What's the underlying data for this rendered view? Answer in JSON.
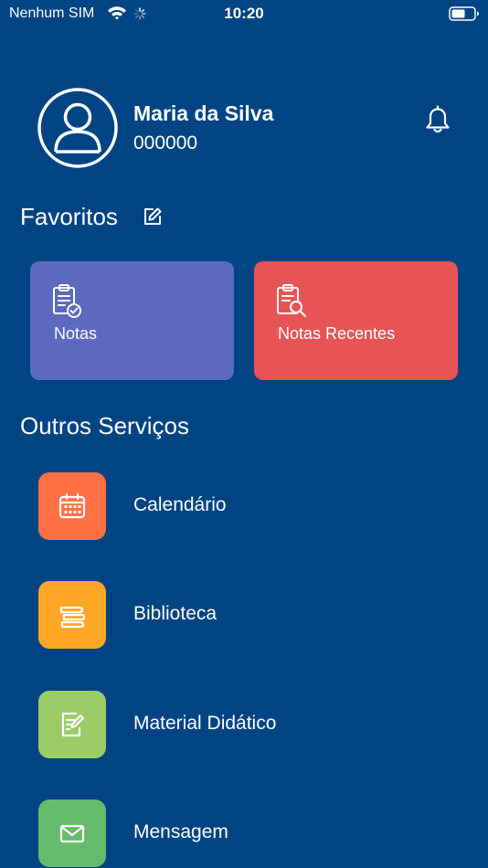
{
  "status_bar": {
    "carrier": "Nenhum SIM",
    "time": "10:20"
  },
  "profile": {
    "name": "Maria da Silva",
    "id": "000000"
  },
  "favorites": {
    "title": "Favoritos",
    "cards": [
      {
        "label": "Notas",
        "color": "#5c69be",
        "icon": "clipboard-check-icon"
      },
      {
        "label": "Notas Recentes",
        "color": "#e75455",
        "icon": "clipboard-search-icon"
      }
    ]
  },
  "services": {
    "title": "Outros Serviços",
    "items": [
      {
        "label": "Calendário",
        "color": "#ff7043",
        "icon": "calendar-icon"
      },
      {
        "label": "Biblioteca",
        "color": "#ffa726",
        "icon": "books-icon"
      },
      {
        "label": "Material Didático",
        "color": "#9ccc65",
        "icon": "document-edit-icon"
      },
      {
        "label": "Mensagem",
        "color": "#66bb6a",
        "icon": "envelope-icon"
      }
    ]
  },
  "colors": {
    "background": "#004484",
    "text": "#ffffff"
  }
}
